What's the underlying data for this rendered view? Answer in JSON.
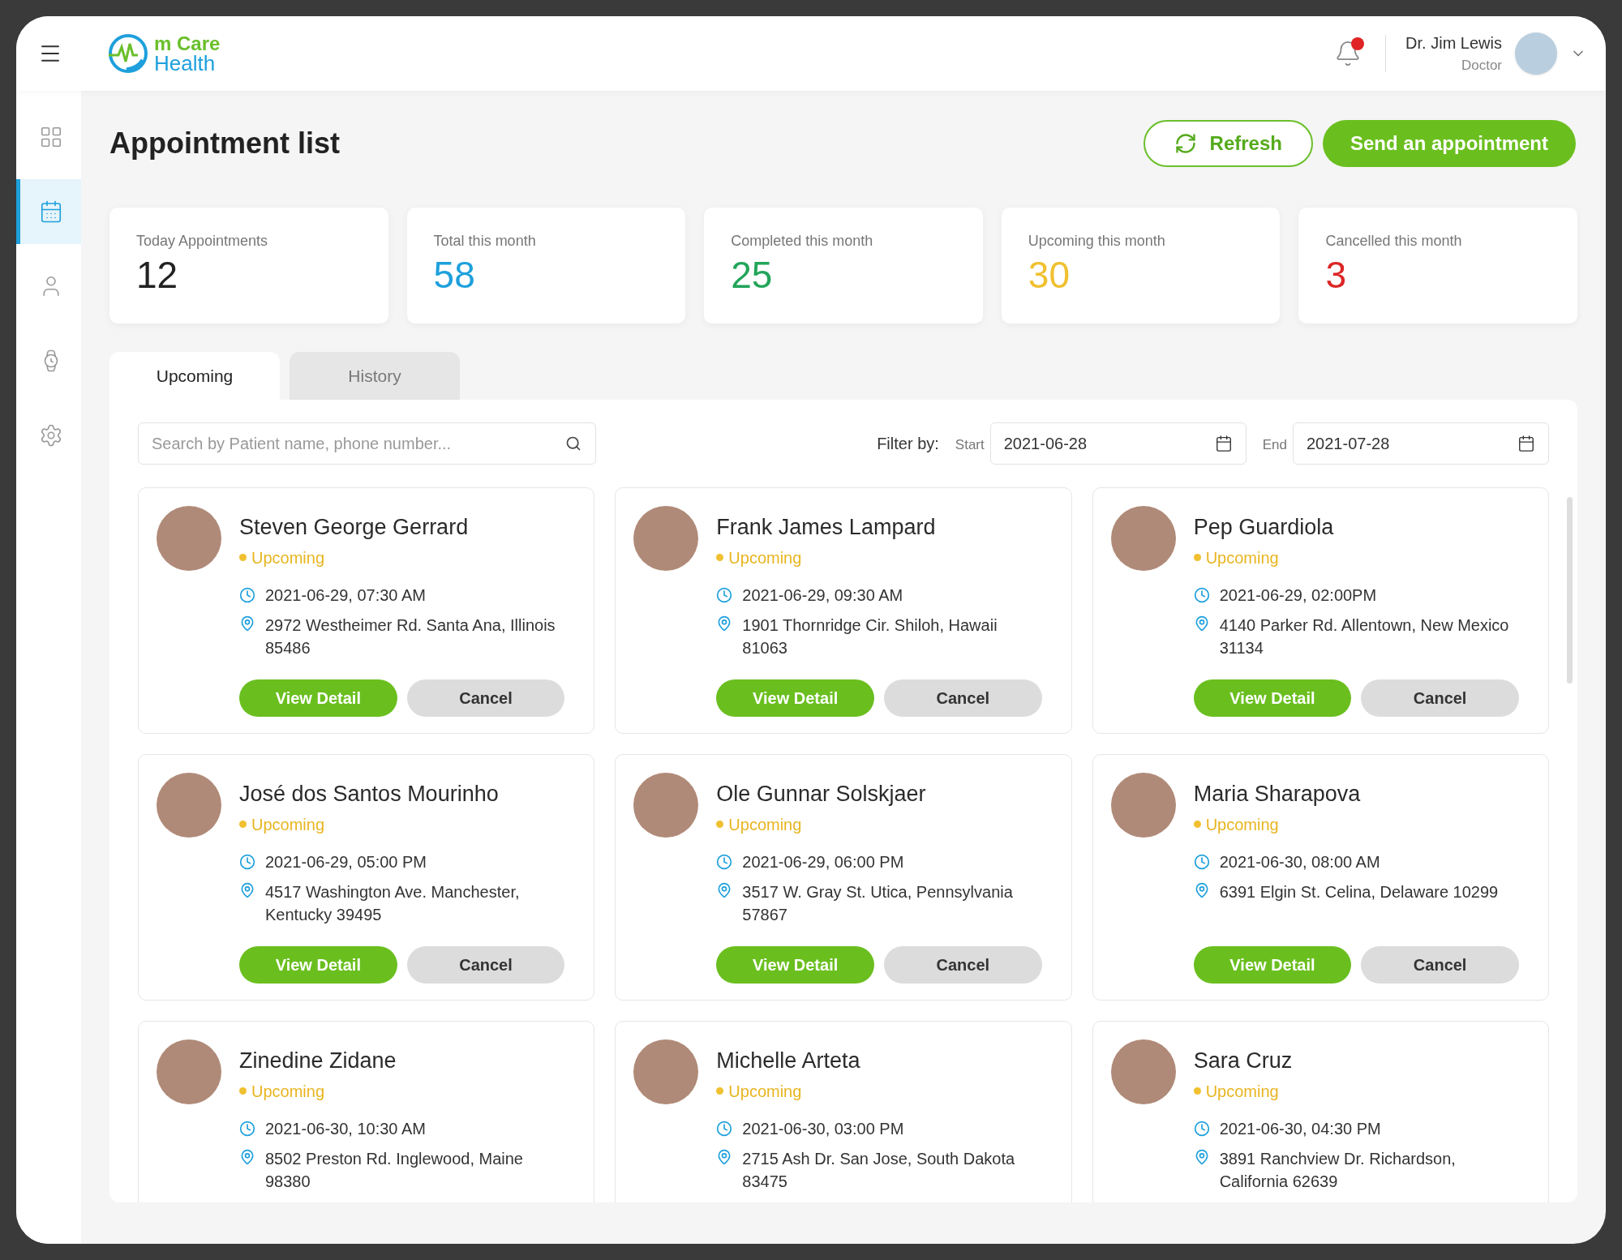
{
  "header": {
    "logo_top": "m Care",
    "logo_bottom": "Health",
    "notification": true,
    "user_name": "Dr. Jim Lewis",
    "user_role": "Doctor"
  },
  "sidebar": {
    "items": [
      {
        "selected": false
      },
      {
        "selected": true
      },
      {
        "selected": false
      },
      {
        "selected": false
      },
      {
        "selected": false
      }
    ]
  },
  "page": {
    "title": "Appointment list",
    "refresh": "Refresh",
    "send": "Send an appointment"
  },
  "stats": [
    {
      "label": "Today Appointments",
      "value": "12",
      "color": "#222222"
    },
    {
      "label": "Total this month",
      "value": "58",
      "color": "#1ea0dc"
    },
    {
      "label": "Completed this month",
      "value": "25",
      "color": "#22a55a"
    },
    {
      "label": "Upcoming this month",
      "value": "30",
      "color": "#f0c030"
    },
    {
      "label": "Cancelled this month",
      "value": "3",
      "color": "#dc2626"
    }
  ],
  "tabs": [
    {
      "label": "Upcoming",
      "selected": true
    },
    {
      "label": "History",
      "selected": false
    }
  ],
  "search": {
    "placeholder": "Search by Patient name, phone number..."
  },
  "filter": {
    "label": "Filter by:",
    "start_label": "Start",
    "start": "2021-06-28",
    "end_label": "End",
    "end": "2021-07-28"
  },
  "appointments": [
    {
      "name": "Steven George Gerrard",
      "status": "Upcoming",
      "time": "2021-06-29, 07:30 AM",
      "address": "2972 Westheimer Rd. Santa Ana, Illinois 85486",
      "view": "View Detail",
      "cancel": "Cancel"
    },
    {
      "name": "Frank James Lampard",
      "status": "Upcoming",
      "time": "2021-06-29, 09:30 AM",
      "address": "1901 Thornridge Cir. Shiloh, Hawaii 81063",
      "view": "View Detail",
      "cancel": "Cancel"
    },
    {
      "name": "Pep Guardiola",
      "status": "Upcoming",
      "time": "2021-06-29, 02:00PM",
      "address": "4140 Parker Rd. Allentown, New Mexico 31134",
      "view": "View Detail",
      "cancel": "Cancel"
    },
    {
      "name": "José dos Santos Mourinho",
      "status": "Upcoming",
      "time": "2021-06-29, 05:00 PM",
      "address": "4517 Washington Ave. Manchester, Kentucky 39495",
      "view": "View Detail",
      "cancel": "Cancel"
    },
    {
      "name": "Ole Gunnar Solskjaer",
      "status": "Upcoming",
      "time": "2021-06-29, 06:00 PM",
      "address": "3517 W. Gray St. Utica, Pennsylvania 57867",
      "view": "View Detail",
      "cancel": "Cancel"
    },
    {
      "name": "Maria Sharapova",
      "status": "Upcoming",
      "time": "2021-06-30, 08:00 AM",
      "address": "6391 Elgin St. Celina, Delaware 10299",
      "view": "View Detail",
      "cancel": "Cancel"
    },
    {
      "name": "Zinedine Zidane",
      "status": "Upcoming",
      "time": "2021-06-30, 10:30 AM",
      "address": "8502 Preston Rd. Inglewood, Maine 98380"
    },
    {
      "name": "Michelle Arteta",
      "status": "Upcoming",
      "time": "2021-06-30, 03:00 PM",
      "address": "2715 Ash Dr. San Jose, South Dakota 83475"
    },
    {
      "name": "Sara Cruz",
      "status": "Upcoming",
      "time": "2021-06-30, 04:30 PM",
      "address": "3891 Ranchview Dr. Richardson, California 62639"
    }
  ]
}
